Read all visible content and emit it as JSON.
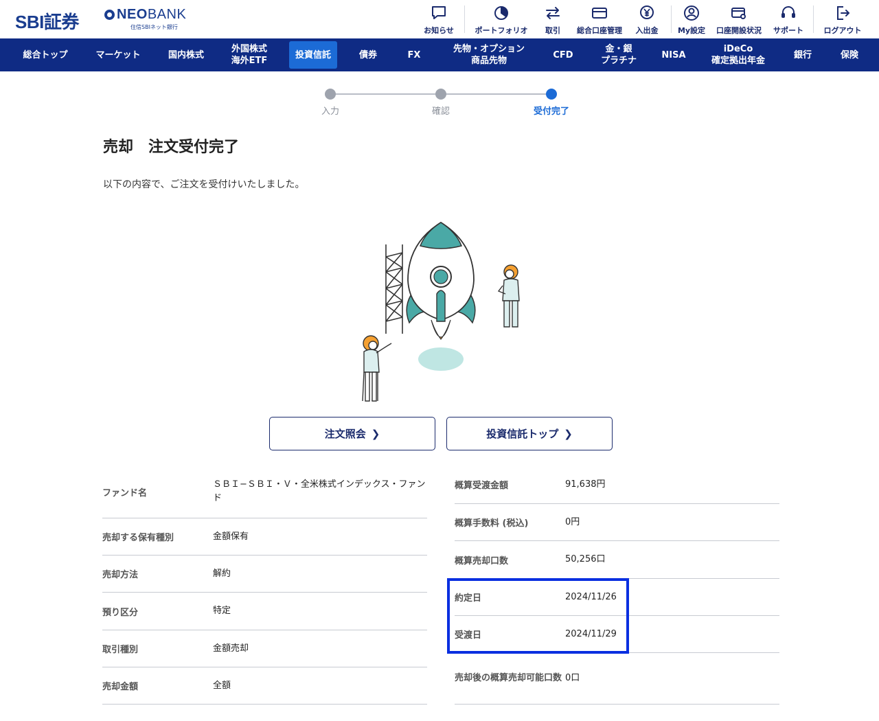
{
  "brand": {
    "logo_text": "SBI証券",
    "partner_logo": {
      "brand": "NEO",
      "suffix": "BANK",
      "sub": "住信SBIネット銀行"
    }
  },
  "utility_nav": [
    {
      "label": "お知らせ",
      "icon": "chat-bubble-icon"
    },
    {
      "label": "ポートフォリオ",
      "icon": "pie-chart-icon"
    },
    {
      "label": "取引",
      "icon": "swap-arrows-icon"
    },
    {
      "label": "総合口座管理",
      "icon": "card-icon"
    },
    {
      "label": "入出金",
      "icon": "yen-coin-icon"
    },
    {
      "label": "My設定",
      "icon": "user-gear-icon"
    },
    {
      "label": "口座開設状況",
      "icon": "card-search-icon"
    },
    {
      "label": "サポート",
      "icon": "headset-icon"
    },
    {
      "label": "ログアウト",
      "icon": "logout-icon"
    }
  ],
  "main_nav": [
    {
      "label": "総合トップ"
    },
    {
      "label": "マーケット"
    },
    {
      "label": "国内株式"
    },
    {
      "label": "外国株式\n海外ETF"
    },
    {
      "label": "投資信託",
      "active": true
    },
    {
      "label": "債券"
    },
    {
      "label": "FX"
    },
    {
      "label": "先物・オプション\n商品先物"
    },
    {
      "label": "CFD"
    },
    {
      "label": "金・銀\nプラチナ"
    },
    {
      "label": "NISA"
    },
    {
      "label": "iDeCo\n確定拠出年金"
    },
    {
      "label": "銀行"
    },
    {
      "label": "保険"
    }
  ],
  "stepper": {
    "steps": [
      "入力",
      "確認",
      "受付完了"
    ],
    "current_step": 3
  },
  "page": {
    "title": "売却　注文受付完了",
    "lead": "以下の内容で、ご注文を受付けいたしました。"
  },
  "actions": {
    "order_inquiry": "注文照会",
    "fund_top": "投資信託トップ"
  },
  "order_details_left": [
    {
      "label": "ファンド名",
      "value": "ＳＢＩ−ＳＢＩ・Ｖ・全米株式インデックス・ファンド"
    },
    {
      "label": "売却する保有種別",
      "value": "金額保有"
    },
    {
      "label": "売却方法",
      "value": "解約"
    },
    {
      "label": "預り区分",
      "value": "特定"
    },
    {
      "label": "取引種別",
      "value": "金額売却"
    },
    {
      "label": "売却金額",
      "value": "全額"
    }
  ],
  "order_details_right": [
    {
      "label": "概算受渡金額",
      "value": "91,638円"
    },
    {
      "label": "概算手数料 (税込)",
      "value": "0円"
    },
    {
      "label": "概算売却口数",
      "value": "50,256口"
    },
    {
      "label": "約定日",
      "value": "2024/11/26"
    },
    {
      "label": "受渡日",
      "value": "2024/11/29"
    },
    {
      "label": "売却後の概算売却可能口数",
      "value": "0口"
    }
  ],
  "colors": {
    "nav_bg": "#0f2b84",
    "nav_active": "#1c6bd6",
    "brand_navy": "#1a3d8f",
    "highlight_box": "#0a2fe0",
    "rocket_teal": "#4aa9a6"
  }
}
